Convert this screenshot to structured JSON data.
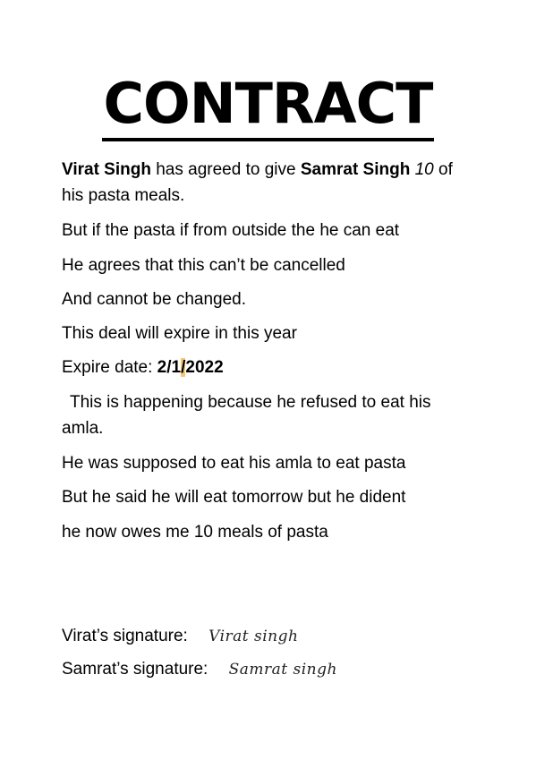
{
  "title": "CONTRACT",
  "para1": {
    "name_a": "Virat Singh",
    "text_a": " has agreed to give ",
    "name_b": "Samrat Singh",
    "number": "10",
    "text_b": " of",
    "text_c": "his pasta meals."
  },
  "lines": {
    "l2": "But if the pasta if from outside the he can eat",
    "l3": "He agrees that this can’t be cancelled",
    "l4": "And cannot be changed.",
    "l5": "This deal will expire in this year"
  },
  "expire": {
    "label": "Expire date: ",
    "date_part1": "2/1",
    "date_sep": "/",
    "date_part2": "2022"
  },
  "para2": {
    "line1": "This is happening because he refused to eat his",
    "line2": "amla."
  },
  "lines2": {
    "l1": "He was supposed to eat his amla to eat pasta",
    "l2": "But he said he will eat tomorrow but he dident",
    "l3": "he now owes me 10 meals of pasta"
  },
  "signatures": {
    "virat_label": "Virat’s signature:",
    "virat_sign": "Virat singh",
    "samrat_label": "Samrat’s signature:",
    "samrat_sign": "Samrat singh"
  },
  "colors": {
    "highlight": "#f7c873"
  }
}
